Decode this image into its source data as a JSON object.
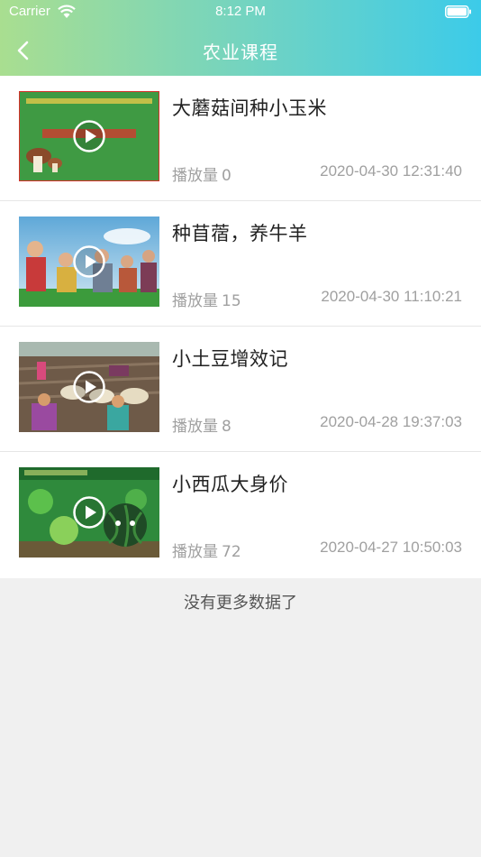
{
  "status_bar": {
    "carrier": "Carrier",
    "time": "8:12 PM"
  },
  "nav": {
    "title": "农业课程",
    "back_icon": "chevron-left-icon"
  },
  "courses": [
    {
      "title": "大蘑菇间种小玉米",
      "views_label": "播放量",
      "views": "0",
      "date": "2020-04-30 12:31:40"
    },
    {
      "title": "种苜蓿，养牛羊",
      "views_label": "播放量",
      "views": "15",
      "date": "2020-04-30 11:10:21"
    },
    {
      "title": "小土豆增效记",
      "views_label": "播放量",
      "views": "8",
      "date": "2020-04-28 19:37:03"
    },
    {
      "title": "小西瓜大身价",
      "views_label": "播放量",
      "views": "72",
      "date": "2020-04-27 10:50:03"
    }
  ],
  "footer": {
    "no_more": "没有更多数据了"
  },
  "colors": {
    "header_start": "#a9de90",
    "header_end": "#3ccbe9",
    "meta_text": "#a0a0a0"
  }
}
